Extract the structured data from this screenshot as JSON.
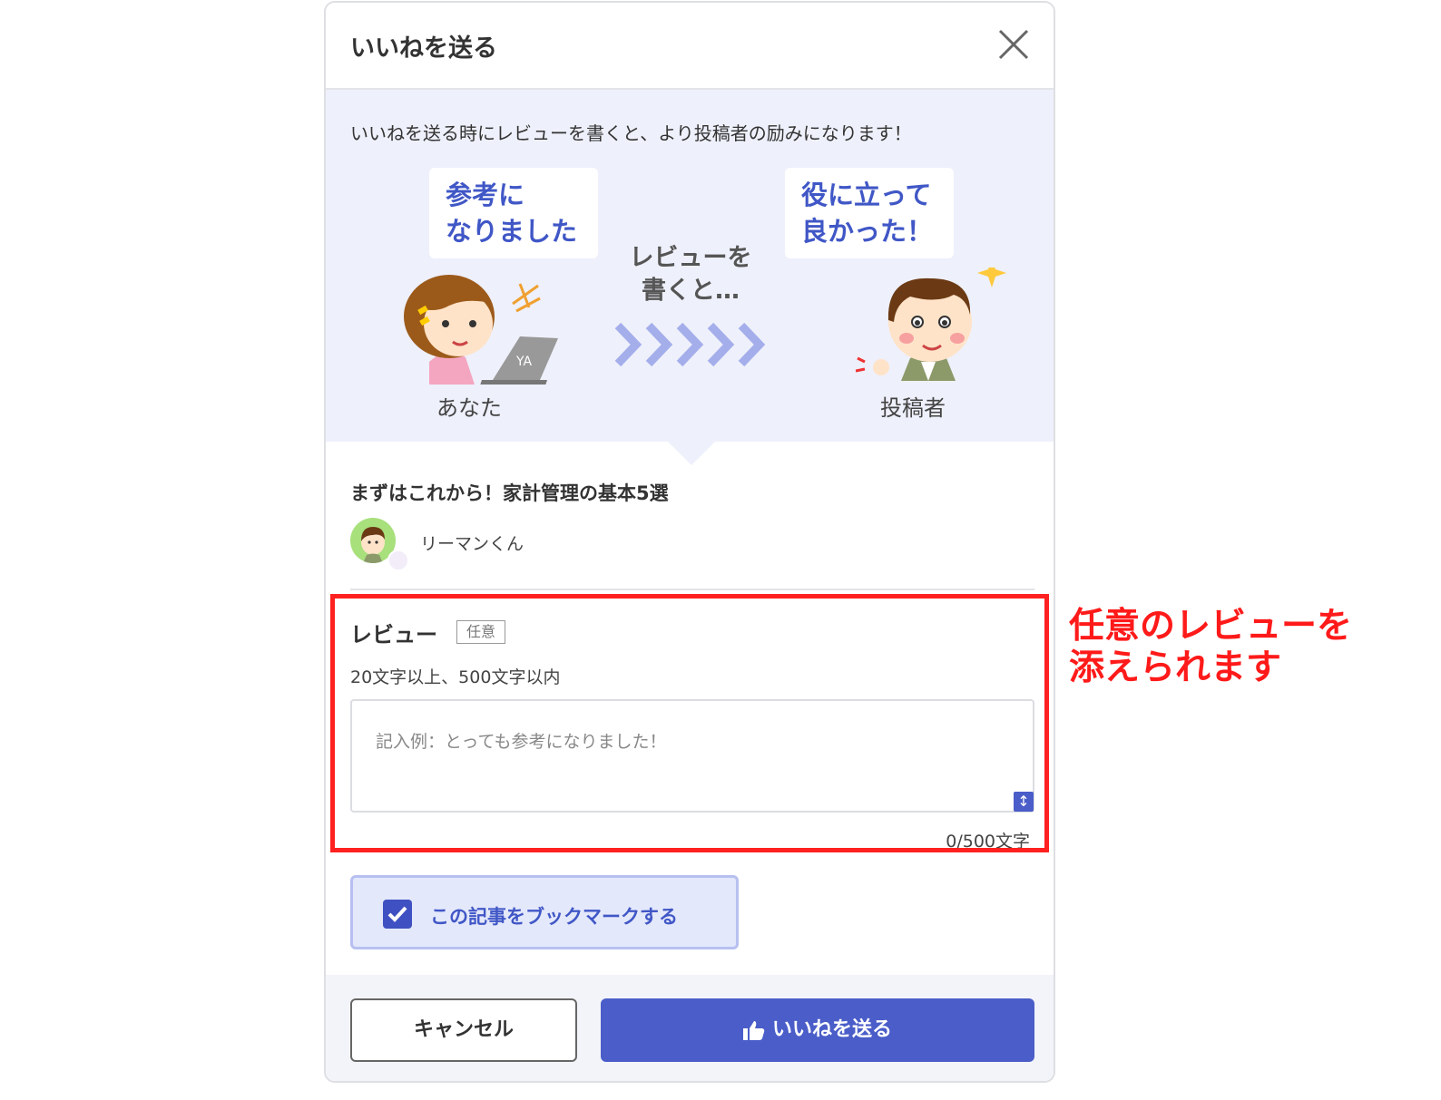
{
  "dialog": {
    "title": "いいねを送る",
    "banner_text": "いいねを送る時にレビューを書くと、より投稿者の励みになります！",
    "bubble_you_line1": "参考に",
    "bubble_you_line2": "なりました",
    "bubble_author_line1": "役に立って",
    "bubble_author_line2": "良かった！",
    "write_line1": "レビューを",
    "write_line2": "書くと…",
    "you_label": "あなた",
    "author_label": "投稿者",
    "laptop_mark": "YA"
  },
  "article": {
    "title": "まずはこれから！家計管理の基本5選",
    "author": "リーマンくん"
  },
  "review": {
    "label": "レビュー",
    "optional_badge": "任意",
    "hint": "20文字以上、500文字以内",
    "placeholder": "記入例：とっても参考になりました！",
    "value": "",
    "char_count": "0/500文字"
  },
  "bookmark": {
    "label": "この記事をブックマークする",
    "checked": true
  },
  "footer": {
    "cancel_label": "キャンセル",
    "send_label": "いいねを送る"
  },
  "annotation": {
    "line1": "任意のレビューを",
    "line2": "添えられます"
  },
  "colors": {
    "accent": "#4a5dc8",
    "banner_bg": "#eef0fb",
    "highlight": "#ff2020"
  },
  "icons": [
    "close-icon",
    "resize-icon",
    "checkbox-check-icon",
    "thumbs-up-icon",
    "chevrons-right-icon",
    "sparkle-icon"
  ]
}
